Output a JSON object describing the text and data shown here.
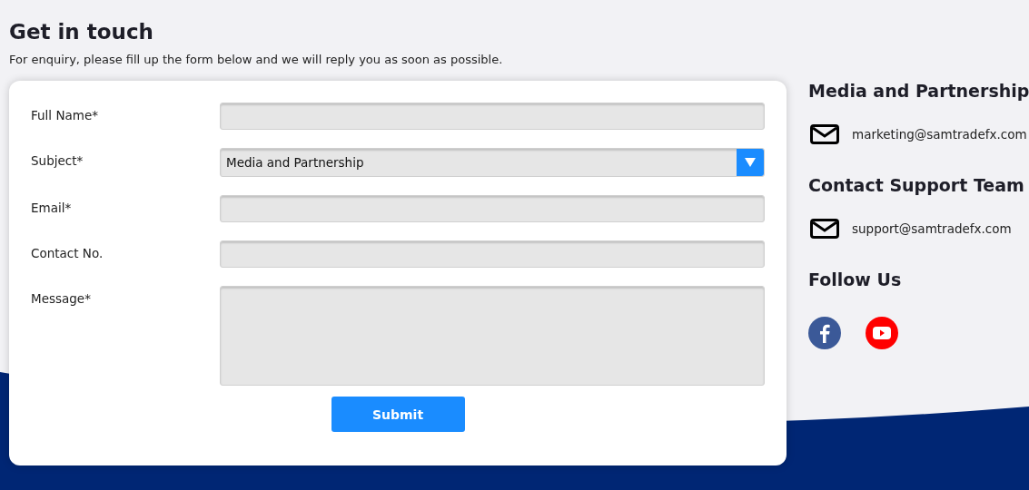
{
  "heading": "Get in touch",
  "intro": "For enquiry, please fill up the form below and we will reply you as soon as possible.",
  "form": {
    "fields": [
      {
        "kind": "text",
        "label": "Full Name*"
      },
      {
        "kind": "select",
        "label": "Subject*",
        "value": "Media and Partnership"
      },
      {
        "kind": "text",
        "label": "Email*"
      },
      {
        "kind": "text",
        "label": "Contact No."
      },
      {
        "kind": "textarea",
        "label": "Message*"
      }
    ],
    "submit": "Submit"
  },
  "contacts": [
    {
      "title": "Media and Partnership",
      "email": "marketing@samtradefx.com"
    },
    {
      "title": "Contact Support Team",
      "email": "support@samtradefx.com"
    }
  ],
  "follow": {
    "title": "Follow Us",
    "links": [
      {
        "kind": "facebook"
      },
      {
        "kind": "youtube"
      }
    ]
  }
}
